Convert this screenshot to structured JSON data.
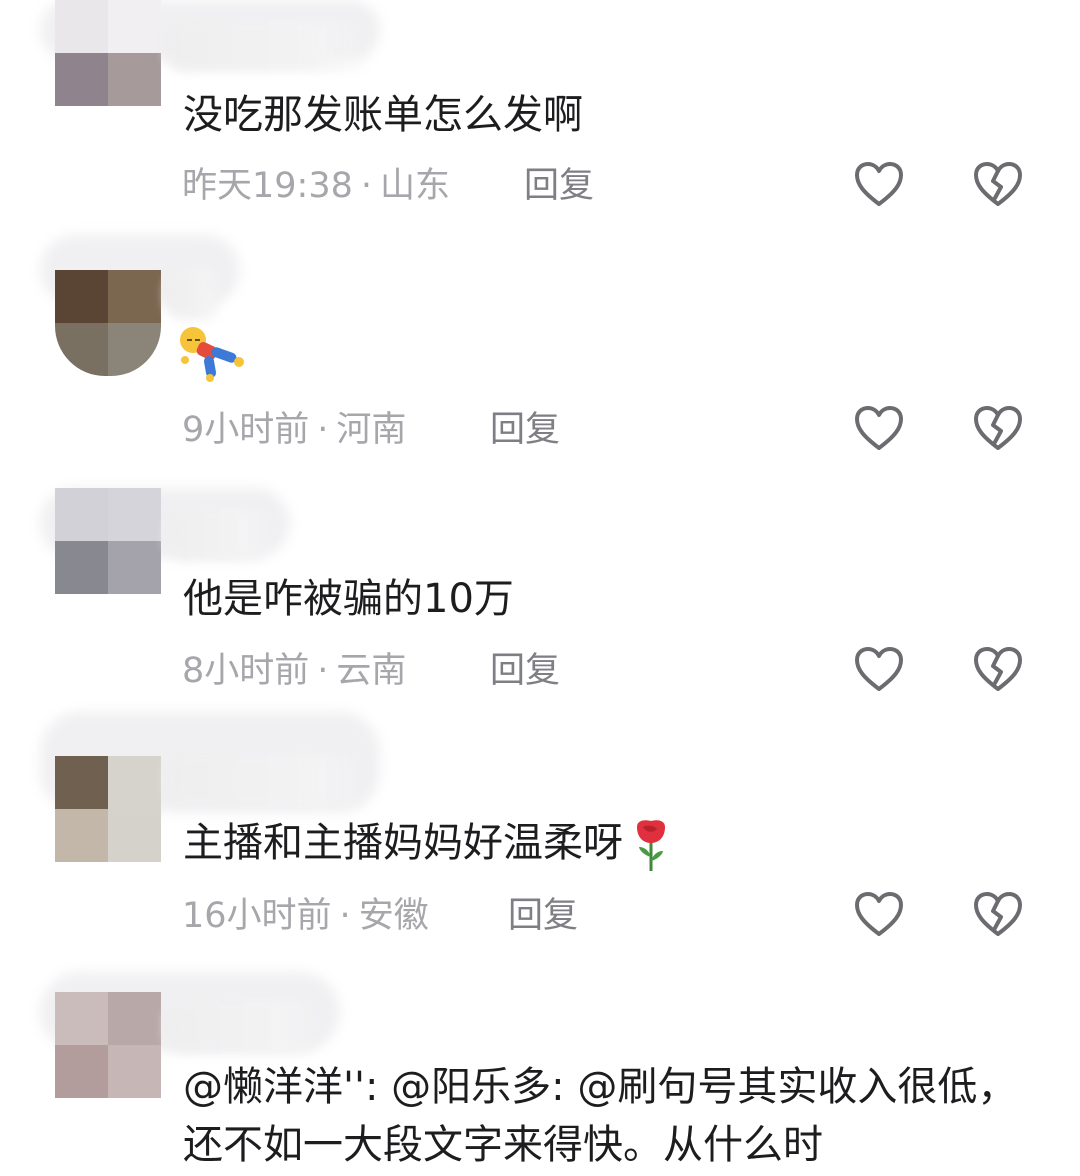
{
  "comments": [
    {
      "text": "没吃那发账单怎么发啊",
      "time": "昨天19:38",
      "location": "山东",
      "reply_label": "回复",
      "avatar_colors": [
        "#8f848d",
        "#a69a9a",
        "#e9e7ea",
        "#f1eff1"
      ]
    },
    {
      "sticker": "lying-cartoon-figure-sticker",
      "time": "9小时前",
      "location": "河南",
      "reply_label": "回复",
      "avatar_colors": [
        "#5a4535",
        "#7b6650",
        "#7a7062",
        "#8b8479"
      ]
    },
    {
      "text": "他是咋被骗的10万",
      "time": "8小时前",
      "location": "云南",
      "reply_label": "回复",
      "avatar_colors": [
        "#d2d1d7",
        "#d5d4da",
        "#888891",
        "#a4a3ab"
      ]
    },
    {
      "text": "主播和主播妈妈好温柔呀",
      "emoji": "rose-icon",
      "time": "16小时前",
      "location": "安徽",
      "reply_label": "回复",
      "avatar_colors": [
        "#6f604f",
        "#d6d3cc",
        "#c2b7a9",
        "#d5d1cb"
      ]
    },
    {
      "text": "@懒洋洋'': @阳乐多: @刷句号其实收入很低，还不如一大段文字来得快。从什么时",
      "avatar_colors": [
        "#cbbcbc",
        "#b8a9a8",
        "#b39c9c",
        "#c7b6b6"
      ]
    }
  ],
  "meta_separator": "·",
  "icons": {
    "like": "heart-outline-icon",
    "dislike": "broken-heart-icon"
  },
  "colors": {
    "text": "#1d1d1f",
    "meta": "#a6a6ab",
    "reply": "#7e7e84",
    "icon": "#6b6b70",
    "rose": "#e0303d"
  }
}
